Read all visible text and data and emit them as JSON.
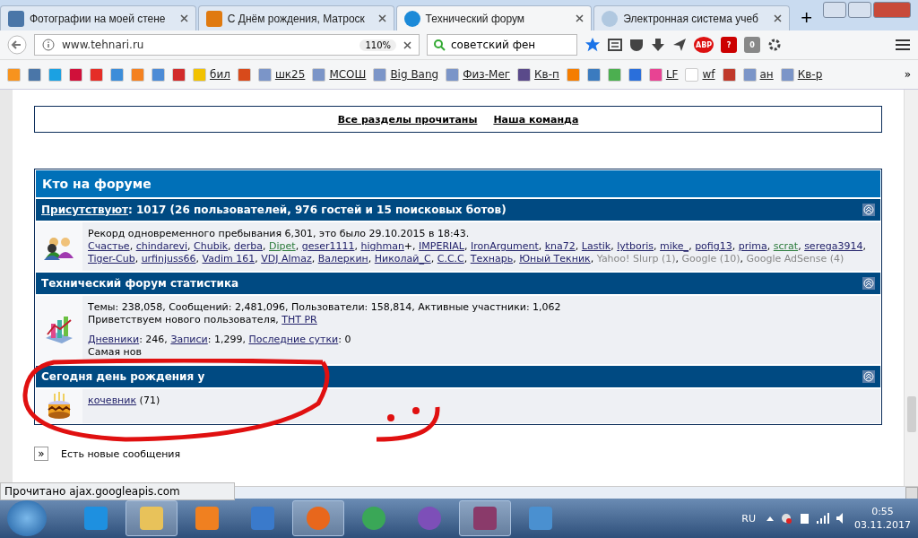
{
  "tabs": [
    {
      "title": "Фотографии на моей стене",
      "selected": false
    },
    {
      "title": "С Днём рождения, Матроск",
      "selected": false
    },
    {
      "title": "Технический форум",
      "selected": true
    },
    {
      "title": "Электронная система учеб",
      "selected": false
    }
  ],
  "new_tab": "+",
  "address": {
    "url": "www.tehnari.ru",
    "zoom": "110%"
  },
  "search": {
    "value": "советский фен"
  },
  "toolbar_badges": [
    "ABP",
    "?",
    "0"
  ],
  "bookmarks": [
    {
      "color": "#f7931e"
    },
    {
      "color": "#4a76a8"
    },
    {
      "color": "#1ba1e2"
    },
    {
      "color": "#d0103a"
    },
    {
      "color": "#e52d27"
    },
    {
      "color": "#3c8dd9"
    },
    {
      "color": "#f48120"
    },
    {
      "color": "#4c8bd6"
    },
    {
      "color": "#d22b2b"
    },
    {
      "label": "бил",
      "color": "#f2c200"
    },
    {
      "color": "#d84a1b"
    },
    {
      "label": "шк25",
      "color": "#7b95c8"
    },
    {
      "label": "МСОШ",
      "color": "#7b95c8"
    },
    {
      "label": "Big Bang",
      "color": "#7b95c8"
    },
    {
      "label": "Физ-Мег",
      "color": "#7b95c8"
    },
    {
      "label": "Кв-п",
      "color": "#5a4a8a"
    },
    {
      "color": "#f57d00"
    },
    {
      "color": "#3b7bbf"
    },
    {
      "color": "#4caf50"
    },
    {
      "color": "#2a6fdb"
    },
    {
      "label": "LF",
      "color": "#e84393"
    },
    {
      "label": "wf",
      "color": "#ffffff"
    },
    {
      "color": "#c0392b"
    },
    {
      "label": "ан",
      "color": "#7b95c8"
    },
    {
      "label": "Кв-р",
      "color": "#7b95c8"
    }
  ],
  "bookmarks_more": "»",
  "top_links": [
    "Все разделы прочитаны",
    "Наша команда"
  ],
  "panel_title": "Кто на форуме",
  "sections": [
    {
      "kind": "online",
      "title": [
        {
          "text": "Присутствуют",
          "link": true
        },
        {
          "text": ": 1017 (26 пользователей, 976 гостей и 15 поисковых ботов)",
          "link": false
        }
      ],
      "record": "Рекорд одновременного пребывания 6,301, это было 29.10.2015 в 18:43.",
      "separator": ", ",
      "users": [
        {
          "name": "Счастье",
          "kind": "member"
        },
        {
          "name": "chindarevi",
          "kind": "member"
        },
        {
          "name": "Chubik",
          "kind": "member"
        },
        {
          "name": "derba",
          "kind": "member"
        },
        {
          "name": "Dipet",
          "kind": "moderator"
        },
        {
          "name": "geser1111",
          "kind": "member"
        },
        {
          "name": "highman",
          "kind": "member",
          "after": "+"
        },
        {
          "name": "IMPERIAL",
          "kind": "member"
        },
        {
          "name": "IronArgument",
          "kind": "member"
        },
        {
          "name": "kna72",
          "kind": "member"
        },
        {
          "name": "Lastik",
          "kind": "member"
        },
        {
          "name": "lytboris",
          "kind": "member"
        },
        {
          "name": "mike_",
          "kind": "member"
        },
        {
          "name": "pofig13",
          "kind": "member"
        },
        {
          "name": "prima",
          "kind": "member"
        },
        {
          "name": "scrat",
          "kind": "moderator"
        },
        {
          "name": "serega3914",
          "kind": "member"
        },
        {
          "name": "Tiger-Cub",
          "kind": "member"
        },
        {
          "name": "urfinjuss66",
          "kind": "member"
        },
        {
          "name": "Vadim 161",
          "kind": "member"
        },
        {
          "name": "VDJ Almaz",
          "kind": "member"
        },
        {
          "name": "Валеркин",
          "kind": "member"
        },
        {
          "name": "Николай_С",
          "kind": "member"
        },
        {
          "name": "C.C.C",
          "kind": "member"
        },
        {
          "name": "Технарь",
          "kind": "member"
        },
        {
          "name": "Юный Текник",
          "kind": "member"
        },
        {
          "name": "Yahoo! Slurp (1)",
          "kind": "bot"
        },
        {
          "name": "Google (10)",
          "kind": "bot"
        },
        {
          "name": "Google AdSense (4)",
          "kind": "bot"
        }
      ]
    },
    {
      "kind": "stats",
      "title": [
        {
          "text": "Технический форум статистика",
          "link": false
        }
      ],
      "lines": [
        [
          {
            "text": "Темы: 238,058, Сообщений: 2,481,096, Пользователи: 158,814, Активные участники: 1,062",
            "link": false
          }
        ],
        [
          {
            "text": "Приветствуем нового пользователя, ",
            "link": false
          },
          {
            "text": "THT PR",
            "link": true
          }
        ],
        [
          {
            "text": "Дневники",
            "link": true
          },
          {
            "text": ": 246, ",
            "link": false
          },
          {
            "text": "Записи",
            "link": true
          },
          {
            "text": ": 1,299, ",
            "link": false
          },
          {
            "text": "Последние сутки",
            "link": true
          },
          {
            "text": ": 0",
            "link": false
          }
        ],
        [
          {
            "text": "Самая нов",
            "link": false
          }
        ]
      ]
    },
    {
      "kind": "birthday",
      "title": [
        {
          "text": "Сегодня день рождения у",
          "link": false
        }
      ],
      "lines": [
        [
          {
            "text": "кочевник",
            "link": true
          },
          {
            "text": " (71)",
            "link": false
          }
        ]
      ]
    }
  ],
  "new_posts": {
    "arrow": "»",
    "label": "Есть новые сообщения"
  },
  "status": "Прочитано ajax.googleapis.com",
  "taskbar": {
    "apps": [
      {
        "selected": false
      },
      {
        "selected": true
      },
      {
        "selected": false
      },
      {
        "selected": false
      },
      {
        "selected": true
      },
      {
        "selected": false
      },
      {
        "selected": false
      },
      {
        "selected": true
      },
      {
        "selected": false
      }
    ],
    "lang": "RU",
    "time": "0:55",
    "date": "03.11.2017"
  }
}
